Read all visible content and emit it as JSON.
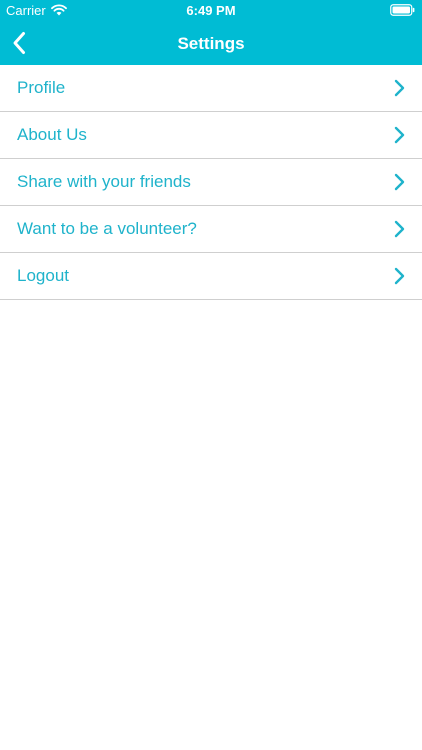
{
  "colors": {
    "accent": "#00BCD4",
    "item_text": "#1FB3CB",
    "separator": "#CFCFCF",
    "background": "#FFFFFF"
  },
  "status_bar": {
    "carrier": "Carrier",
    "time": "6:49 PM",
    "wifi_icon": "wifi-icon",
    "battery_icon": "battery-icon"
  },
  "nav": {
    "title": "Settings",
    "back_icon": "chevron-left-icon"
  },
  "menu": {
    "items": [
      {
        "label": "Profile",
        "icon": "chevron-right-icon"
      },
      {
        "label": "About Us",
        "icon": "chevron-right-icon"
      },
      {
        "label": "Share with your friends",
        "icon": "chevron-right-icon"
      },
      {
        "label": "Want to be a volunteer?",
        "icon": "chevron-right-icon"
      },
      {
        "label": "Logout",
        "icon": "chevron-right-icon"
      }
    ]
  }
}
